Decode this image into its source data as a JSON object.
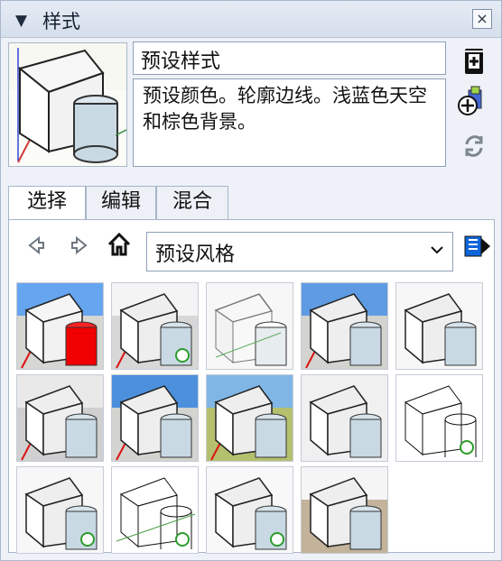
{
  "panel": {
    "title": "样式",
    "close_label": "×"
  },
  "style": {
    "name": "预设样式",
    "description": "预设颜色。轮廓边线。浅蓝色天空和棕色背景。"
  },
  "tabs": [
    {
      "label": "选择",
      "active": true
    },
    {
      "label": "编辑",
      "active": false
    },
    {
      "label": "混合",
      "active": false
    }
  ],
  "browser": {
    "back_icon": "arrow-left-icon",
    "forward_icon": "arrow-right-icon",
    "home_icon": "home-icon",
    "collection_label": "预设风格",
    "detail_icon": "details-arrow-icon"
  },
  "thumbnails": [
    {
      "style": "blue-sky red-cylinder"
    },
    {
      "style": "gray shaded dimension"
    },
    {
      "style": "sketchy xray"
    },
    {
      "style": "blue-sky shaded"
    },
    {
      "style": "gray shaded plain"
    },
    {
      "style": "gray shaded plain"
    },
    {
      "style": "blue-sky shaded"
    },
    {
      "style": "sky-green shaded"
    },
    {
      "style": "gray shaded plain"
    },
    {
      "style": "white sketch dimension"
    },
    {
      "style": "white shaded dimension"
    },
    {
      "style": "white linework dimension"
    },
    {
      "style": "white shaded dimension"
    },
    {
      "style": "earth-sky shaded"
    }
  ],
  "colors": {
    "accent_blue": "#2d6ee8",
    "preview_cylinder": "#c9d9e4",
    "selected_cylinder": "#f00000",
    "border": "#8ea0b7"
  }
}
